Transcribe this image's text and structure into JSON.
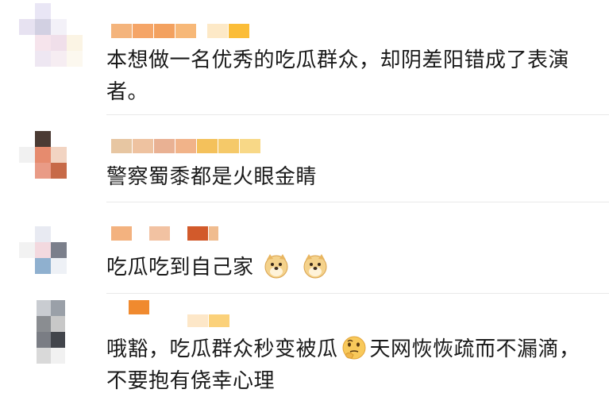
{
  "comments": [
    {
      "text": "本想做一名优秀的吃瓜群众，却阴差阳错成了表演者。"
    },
    {
      "text": "警察蜀黍都是火眼金睛"
    },
    {
      "text": "吃瓜吃到自己家",
      "emojis": [
        "doge-emoji",
        "doge-emoji"
      ]
    },
    {
      "text_before": "哦豁，吃瓜群众秒变被瓜",
      "emoji": "thinking-emoji",
      "text_after": "天网恢恢疏而不漏滴，不要抱有侥幸心理"
    }
  ]
}
